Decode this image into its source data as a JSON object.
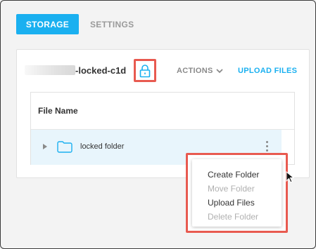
{
  "tabs": {
    "storage": "STORAGE",
    "settings": "SETTINGS"
  },
  "bucket": {
    "name_suffix": "-locked-c1d"
  },
  "toolbar": {
    "actions_label": "ACTIONS",
    "upload_label": "UPLOAD FILES"
  },
  "table": {
    "header": "File Name",
    "rows": [
      {
        "name": "locked folder"
      }
    ]
  },
  "context_menu": {
    "items": [
      {
        "label": "Create Folder",
        "enabled": true
      },
      {
        "label": "Move Folder",
        "enabled": false
      },
      {
        "label": "Upload Files",
        "enabled": true
      },
      {
        "label": "Delete Folder",
        "enabled": false
      }
    ]
  },
  "colors": {
    "accent": "#1ab0f0",
    "highlight_border": "#e85a50",
    "row_selected": "#e8f5fc"
  },
  "icons": {
    "lock": "lock-icon",
    "folder": "folder-icon",
    "expand": "caret-right-icon",
    "more": "kebab-icon",
    "actions_chevron": "chevron-down-icon"
  }
}
